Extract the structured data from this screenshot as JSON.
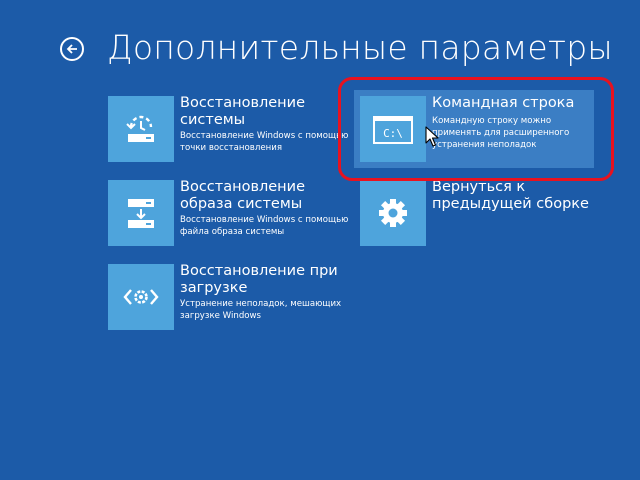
{
  "page": {
    "title": "Дополнительные параметры",
    "back_icon": "back-arrow-circle-icon"
  },
  "colors": {
    "background": "#1c5ba8",
    "tile_icon_bg": "#4ea4dc",
    "selected_tile_bg": "#3b7ec4",
    "highlight_border": "#e8121f"
  },
  "tiles": [
    {
      "title": "Восстановление системы",
      "desc": "Восстановление Windows с помощью точки восстановления",
      "icon": "system-restore-icon"
    },
    {
      "title": "Восстановление образа системы",
      "desc": "Восстановление Windows с помощью файла образа системы",
      "icon": "system-image-recovery-icon"
    },
    {
      "title": "Восстановление при загрузке",
      "desc": "Устранение неполадок, мешающих загрузке Windows",
      "icon": "startup-repair-icon"
    },
    {
      "title": "Командная строка",
      "desc": "Командную строку можно применять для расширенного устранения неполадок",
      "icon": "command-prompt-icon",
      "icon_text": "C:\\",
      "selected": true
    },
    {
      "title": "Вернуться к предыдущей сборке",
      "desc": "",
      "icon": "gear-icon"
    }
  ]
}
